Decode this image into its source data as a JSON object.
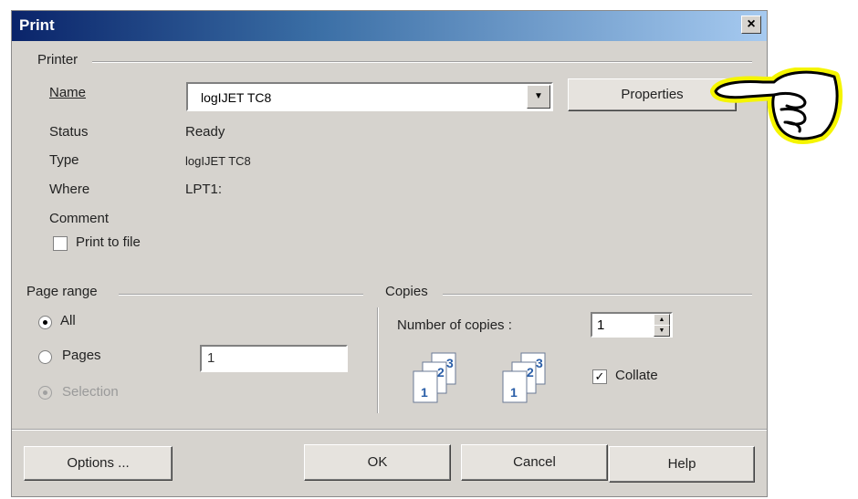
{
  "window": {
    "title": "Print",
    "close_glyph": "×"
  },
  "printer": {
    "group_label": "Printer",
    "name_label": "Name",
    "name_value": "logIJET TC8",
    "properties_label": "Properties",
    "status_label": "Status",
    "status_value": "Ready",
    "type_label": "Type",
    "type_value": "logIJET TC8",
    "where_label": "Where",
    "where_value": "LPT1:",
    "comment_label": "Comment",
    "print_to_file_label": "Print to file",
    "print_to_file_checked": false
  },
  "page_range": {
    "group_label": "Page range",
    "all_label": "All",
    "pages_label": "Pages",
    "pages_value": "1",
    "selection_label": "Selection",
    "selected": "All"
  },
  "copies": {
    "group_label": "Copies",
    "number_label": "Number of copies :",
    "number_value": "1",
    "collate_label": "Collate",
    "collate_checked": true,
    "icon_digits": [
      "1",
      "2",
      "3"
    ]
  },
  "buttons": {
    "options_label": "Options ...",
    "ok_label": "OK",
    "cancel_label": "Cancel",
    "help_label": "Help"
  },
  "annotation": {
    "icon": "pointing-hand-icon",
    "highlight_color": "#f5f500"
  },
  "colors": {
    "title_start": "#0a246a",
    "title_end": "#a6caf0",
    "dialog_bg": "#d6d3ce",
    "icon_blue": "#2a5ea8"
  }
}
